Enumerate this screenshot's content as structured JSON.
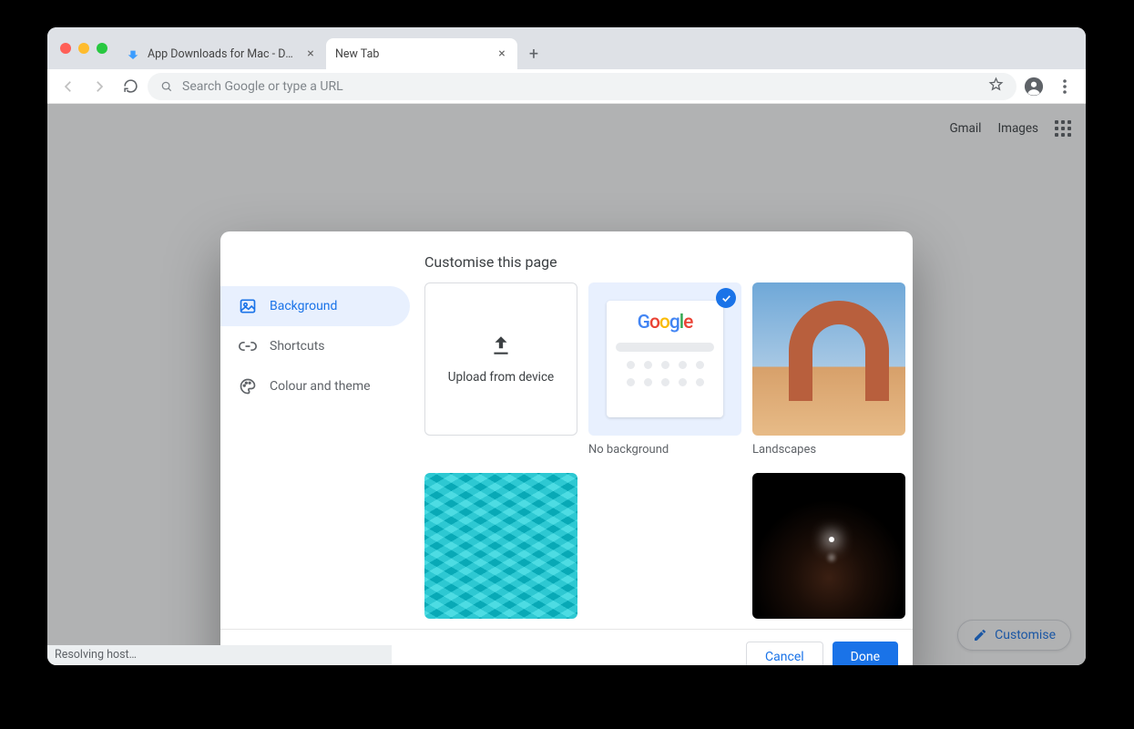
{
  "tabs": [
    {
      "title": "App Downloads for Mac - Dow…"
    },
    {
      "title": "New Tab"
    }
  ],
  "omnibox": {
    "placeholder": "Search Google or type a URL"
  },
  "header_links": {
    "gmail": "Gmail",
    "images": "Images"
  },
  "customise_chip": "Customise",
  "dialog": {
    "title": "Customise this page",
    "side": {
      "background": "Background",
      "shortcuts": "Shortcuts",
      "colour": "Colour and theme"
    },
    "tiles": {
      "upload": "Upload from device",
      "no_bg": "No background",
      "landscapes": "Landscapes"
    },
    "buttons": {
      "cancel": "Cancel",
      "done": "Done"
    }
  },
  "status": "Resolving host…"
}
